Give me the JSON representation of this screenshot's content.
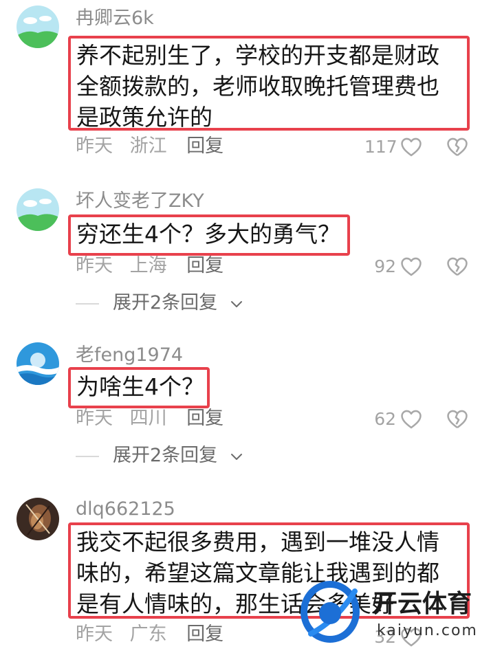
{
  "comments": [
    {
      "username": "冉卿云6k",
      "text": "养不起别生了，学校的开支都是财政全额拨款的，老师收取晚托管理费也是政策允许的",
      "date": "昨天",
      "location": "浙江",
      "reply_label": "回复",
      "likes": "117"
    },
    {
      "username": "坏人变老了ZKY",
      "text": "穷还生4个？多大的勇气？",
      "date": "昨天",
      "location": "上海",
      "reply_label": "回复",
      "likes": "92",
      "expand_label": "展开2条回复"
    },
    {
      "username": "老feng1974",
      "text": "为啥生4个？",
      "date": "昨天",
      "location": "四川",
      "reply_label": "回复",
      "likes": "62",
      "expand_label": "展开2条回复"
    },
    {
      "username": "dlq662125",
      "text": "我交不起很多费用，遇到一堆没人情味的，希望这篇文章能让我遇到的都是有人情味的，那生话会多美好",
      "date": "昨天",
      "location": "广东",
      "reply_label": "回复",
      "likes": "32"
    }
  ],
  "watermark": {
    "brand": "开云体育",
    "domain": "kaiyun.com"
  },
  "colors": {
    "highlight_border": "#e8414c",
    "muted_text": "#a3a3a3",
    "username_text": "#8c8c8c"
  }
}
